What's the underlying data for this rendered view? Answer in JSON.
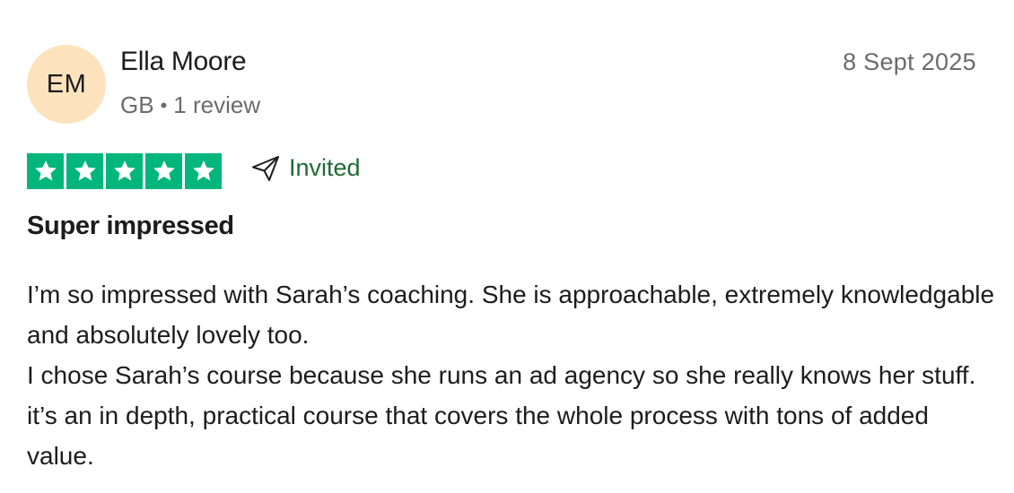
{
  "reviewer": {
    "initials": "EM",
    "name": "Ella Moore",
    "country": "GB",
    "separator": "•",
    "review_count": "1 review",
    "avatar_color": "#fde3bd"
  },
  "review": {
    "date": "8 Sept 2025",
    "rating": 5,
    "rating_max": 5,
    "star_color": "#00b67a",
    "invited_label": "Invited",
    "invited_icon": "paper-plane-icon",
    "title": "Super impressed",
    "paragraphs": [
      "I’m so impressed with Sarah’s coaching. She is approachable, extremely knowledgable and absolutely lovely too.",
      "I chose Sarah’s course because she runs an ad agency so she really knows her stuff. it’s an in depth, practical course that covers the whole process with tons of added value."
    ]
  }
}
